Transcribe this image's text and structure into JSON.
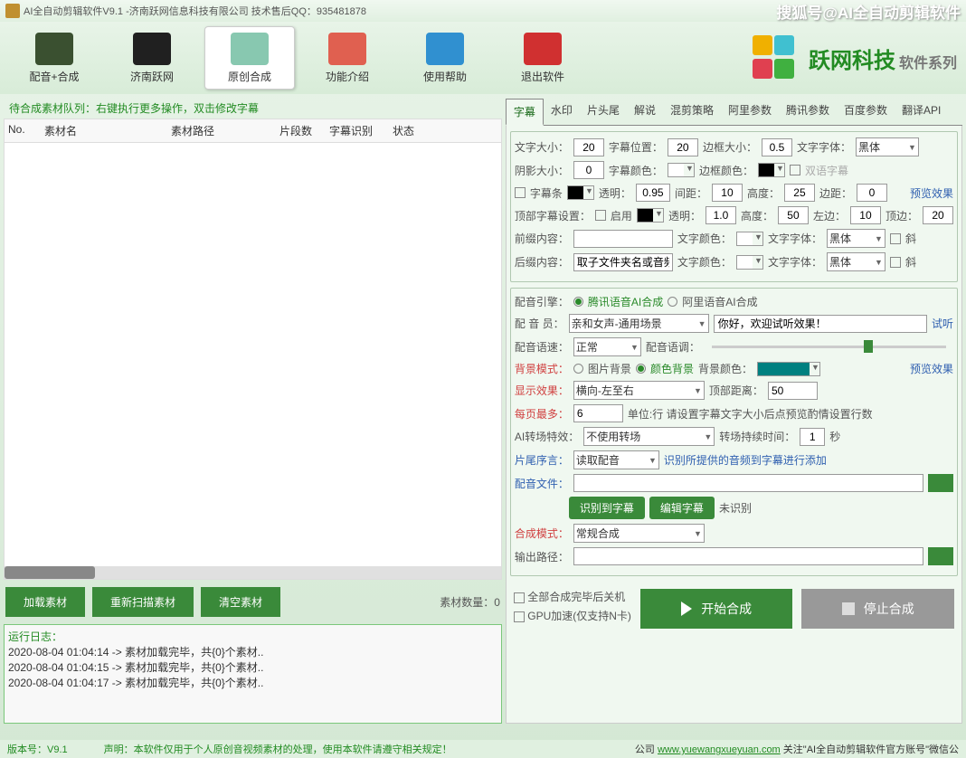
{
  "title": "AI全自动剪辑软件V9.1 -济南跃网信息科技有限公司 技术售后QQ：935481878",
  "titleRight": "搜狐号@AI全自动剪辑软件",
  "toolbar": [
    {
      "label": "配音+合成",
      "icon": "#3a5030"
    },
    {
      "label": "济南跃网",
      "icon": "#202020"
    },
    {
      "label": "原创合成",
      "icon": "#88c8b0",
      "active": true
    },
    {
      "label": "功能介绍",
      "icon": "#e06050"
    },
    {
      "label": "使用帮助",
      "icon": "#3090d0"
    },
    {
      "label": "退出软件",
      "icon": "#d03030"
    }
  ],
  "brand": {
    "main": "跃网科技",
    "sub": "软件系列"
  },
  "listHeader": "待合成素材队列：右键执行更多操作，双击修改字幕",
  "cols": {
    "no": "No.",
    "name": "素材名",
    "path": "素材路径",
    "seg": "片段数",
    "rec": "字幕识别",
    "status": "状态"
  },
  "buttons": {
    "load": "加载素材",
    "rescan": "重新扫描素材",
    "clear": "清空素材"
  },
  "materialCount": "素材数量：0",
  "log": {
    "title": "运行日志：",
    "lines": [
      "2020-08-04 01:04:14 -> 素材加载完毕，共{0}个素材..",
      "2020-08-04 01:04:15 -> 素材加载完毕，共{0}个素材..",
      "2020-08-04 01:04:17 -> 素材加载完毕，共{0}个素材.."
    ]
  },
  "tabs": [
    "字幕",
    "水印",
    "片头尾",
    "解说",
    "混剪策略",
    "阿里参数",
    "腾讯参数",
    "百度参数",
    "翻译API"
  ],
  "s": {
    "fontSizeL": "文字大小：",
    "fontSize": "20",
    "posL": "字幕位置：",
    "pos": "20",
    "borderL": "边框大小：",
    "border": "0.5",
    "fontL": "文字字体：",
    "font": "黑体",
    "shadowL": "阴影大小：",
    "shadow": "0",
    "subColorL": "字幕颜色：",
    "borderColorL": "边框颜色：",
    "bilingual": "双语字幕",
    "subBar": "字幕条",
    "opacityL": "透明：",
    "opacity": "0.95",
    "gapL": "间距：",
    "gap": "10",
    "heightL": "高度：",
    "height": "25",
    "marginL": "边距：",
    "margin": "0",
    "preview": "预览效果",
    "topSubL": "顶部字幕设置：",
    "enable": "启用",
    "topOpacity": "1.0",
    "topHeight": "50",
    "leftL": "左边：",
    "left": "10",
    "topL": "顶边：",
    "top": "20",
    "prefixL": "前缀内容：",
    "prefix": "",
    "textColorL": "文字颜色：",
    "italic": "斜",
    "suffixL": "后缀内容：",
    "suffix": "取子文件夹名或音频",
    "engineL": "配音引擎：",
    "engine1": "腾讯语音AI合成",
    "engine2": "阿里语音AI合成",
    "voiceL": "配 音 员：",
    "voice": "亲和女声-通用场景",
    "voiceText": "你好，欢迎试听效果！",
    "listen": "试听",
    "speedL": "配音语速：",
    "speed": "正常",
    "toneL": "配音语调：",
    "bgModeL": "背景模式：",
    "bgImg": "图片背景",
    "bgColor": "颜色背景",
    "bgColorL": "背景颜色：",
    "dispL": "显示效果：",
    "disp": "横向-左至右",
    "topDistL": "顶部距离：",
    "topDist": "50",
    "maxL": "每页最多：",
    "max": "6",
    "maxHint": "单位:行 请设置字幕文字大小后点预览酌情设置行数",
    "transL": "AI转场特效：",
    "trans": "不使用转场",
    "transDurL": "转场持续时间：",
    "transDur": "1",
    "sec": "秒",
    "tailL": "片尾序言：",
    "tail": "读取配音",
    "tailHint": "识别所提供的音频到字幕进行添加",
    "audioFileL": "配音文件：",
    "recBtn": "识别到字幕",
    "editBtn": "编辑字幕",
    "notRec": "未识别",
    "modeL": "合成模式：",
    "mode": "常规合成",
    "outL": "输出路径：",
    "shutdownChk": "全部合成完毕后关机",
    "gpuChk": "GPU加速(仅支持N卡)",
    "start": "开始合成",
    "stop": "停止合成"
  },
  "footer": {
    "ver": "版本号：V9.1",
    "notice": "声明：本软件仅用于个人原创音视频素材的处理，使用本软件请遵守相关规定！",
    "company": "公司 ",
    "url": "www.yuewangxueyuan.com",
    "tail": " 关注\"AI全自动剪辑软件官方账号\"微信公"
  }
}
